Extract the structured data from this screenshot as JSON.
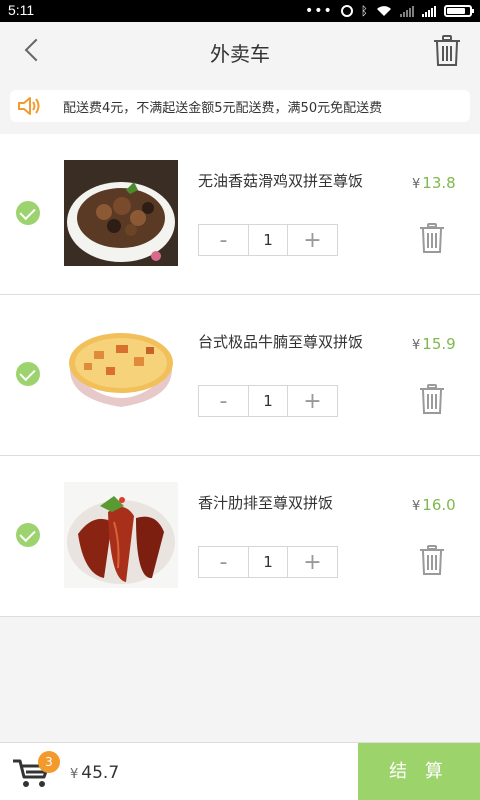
{
  "status_bar": {
    "time": "5:11"
  },
  "header": {
    "title": "外卖车",
    "back_icon": "chevron-left-icon",
    "trash_icon": "trash-icon"
  },
  "notice": {
    "icon": "speaker-icon",
    "text": "配送费4元，不满起送金额5元配送费，满50元免配送费",
    "accent": "#f39a2c"
  },
  "items": [
    {
      "name": "无油香菇滑鸡双拼至尊饭",
      "currency": "¥",
      "price": "13.8",
      "quantity": "1",
      "minus": "-",
      "plus": "+",
      "checked": true
    },
    {
      "name": "台式极品牛腩至尊双拼饭",
      "currency": "¥",
      "price": "15.9",
      "quantity": "1",
      "minus": "-",
      "plus": "+",
      "checked": true
    },
    {
      "name": "香汁肋排至尊双拼饭",
      "currency": "¥",
      "price": "16.0",
      "quantity": "1",
      "minus": "-",
      "plus": "+",
      "checked": true
    }
  ],
  "bottom": {
    "cart_icon": "cart-icon",
    "badge_count": "3",
    "currency": "¥",
    "total": "45.7",
    "checkout_label": "结 算",
    "checkout_color": "#9cd36b"
  },
  "colors": {
    "price": "#7fb94a",
    "check": "#9dd36e",
    "badge": "#f39a2c"
  }
}
